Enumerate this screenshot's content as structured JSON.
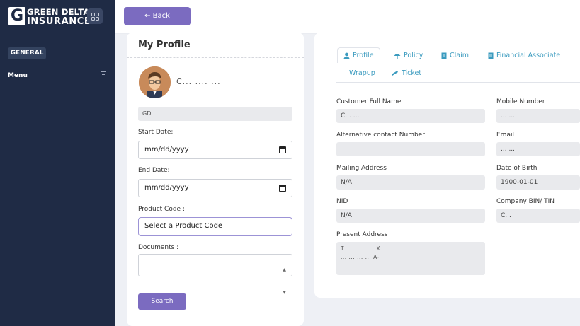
{
  "brand": {
    "logo_letter": "G",
    "line1": "GREEN DELTA",
    "line2": "INSURANCE"
  },
  "sidebar": {
    "section_badge": "GENERAL",
    "menu_label": "Menu"
  },
  "topbar": {
    "back_label": "← Back"
  },
  "profile": {
    "title": "My Profile",
    "customer_name": "C...  ....  ...",
    "policy_id": "GD...  ...  ...",
    "start_date_label": "Start Date:",
    "start_date_placeholder": "mm/dd/yyyy",
    "end_date_label": "End Date:",
    "end_date_placeholder": "mm/dd/yyyy",
    "product_code_label": "Product Code :",
    "product_code_value": "Select a Product Code",
    "documents_label": "Documents :",
    "documents_value": "..  .. ...  .. ..",
    "search_label": "Search"
  },
  "tabs": [
    {
      "label": "Profile",
      "icon": "user-icon"
    },
    {
      "label": "Policy",
      "icon": "umbrella-icon"
    },
    {
      "label": "Claim",
      "icon": "document-icon"
    },
    {
      "label": "Financial Associate",
      "icon": "document-icon"
    },
    {
      "label": "Wrapup",
      "icon": ""
    },
    {
      "label": "Ticket",
      "icon": "ticket-icon"
    }
  ],
  "details": {
    "customer_full_name_label": "Customer Full Name",
    "customer_full_name_value": "C...   ...",
    "mobile_number_label": "Mobile Number",
    "mobile_number_value": "...   ...",
    "alt_contact_label": "Alternative contact Number",
    "alt_contact_value": "",
    "email_label": "Email",
    "email_value": "...  ...",
    "mailing_address_label": "Mailing Address",
    "mailing_address_value": "N/A",
    "dob_label": "Date of Birth",
    "dob_value": "1900-01-01",
    "nid_label": "NID",
    "nid_value": "N/A",
    "company_bin_label": "Company BIN/ TIN",
    "company_bin_value": "C...",
    "present_address_label": "Present Address",
    "present_address_line1": "T...  ...  ...  ...  X",
    "present_address_line2": "...  ...  ...  ...  A-",
    "present_address_line3": "..."
  },
  "colors": {
    "sidebar": "#1f2b45",
    "accent": "#7b6bc0",
    "tab_text": "#3b9bbf",
    "field_bg": "#e9eaed"
  }
}
